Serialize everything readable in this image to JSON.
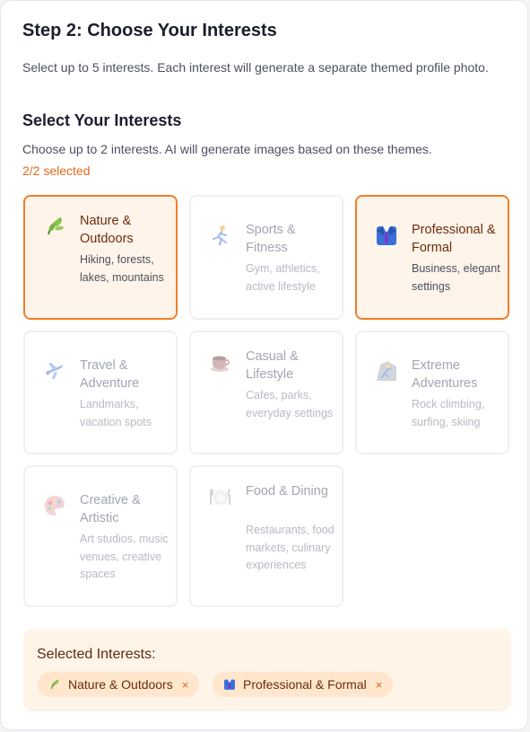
{
  "step": {
    "title": "Step 2: Choose Your Interests",
    "description": "Select up to 5 interests. Each interest will generate a separate themed profile photo."
  },
  "section": {
    "title": "Select Your Interests",
    "description": "Choose up to 2 interests. AI will generate images based on these themes.",
    "count": "2/2 selected"
  },
  "interests": [
    {
      "label": "Nature & Outdoors",
      "desc": "Hiking, forests, lakes, mountains",
      "icon": "leaf-icon",
      "selected": true
    },
    {
      "label": "Sports & Fitness",
      "desc": "Gym, athletics, active lifestyle",
      "icon": "runner-icon",
      "selected": false
    },
    {
      "label": "Professional & Formal",
      "desc": "Business, elegant settings",
      "icon": "suit-icon",
      "selected": true
    },
    {
      "label": "Travel & Adventure",
      "desc": "Landmarks, vacation spots",
      "icon": "airplane-icon",
      "selected": false
    },
    {
      "label": "Casual & Lifestyle",
      "desc": "Cafes, parks, everyday settings",
      "icon": "coffee-icon",
      "selected": false
    },
    {
      "label": "Extreme Adventures",
      "desc": "Rock climbing, surfing, skiing",
      "icon": "climber-icon",
      "selected": false
    },
    {
      "label": "Creative & Artistic",
      "desc": "Art studios, music venues, creative spaces",
      "icon": "palette-icon",
      "selected": false
    },
    {
      "label": "Food & Dining",
      "desc": "Restaurants, food markets, culinary experiences",
      "icon": "plate-icon",
      "selected": false
    }
  ],
  "selected_panel": {
    "title": "Selected Interests:",
    "chips": [
      {
        "label": "Nature & Outdoors",
        "remove": "×",
        "icon": "leaf-icon"
      },
      {
        "label": "Professional & Formal",
        "remove": "×",
        "icon": "suit-icon"
      }
    ]
  },
  "colors": {
    "accent": "#ee7f2b",
    "selected_bg": "#fff4ea",
    "count_text": "#e06a1c"
  }
}
